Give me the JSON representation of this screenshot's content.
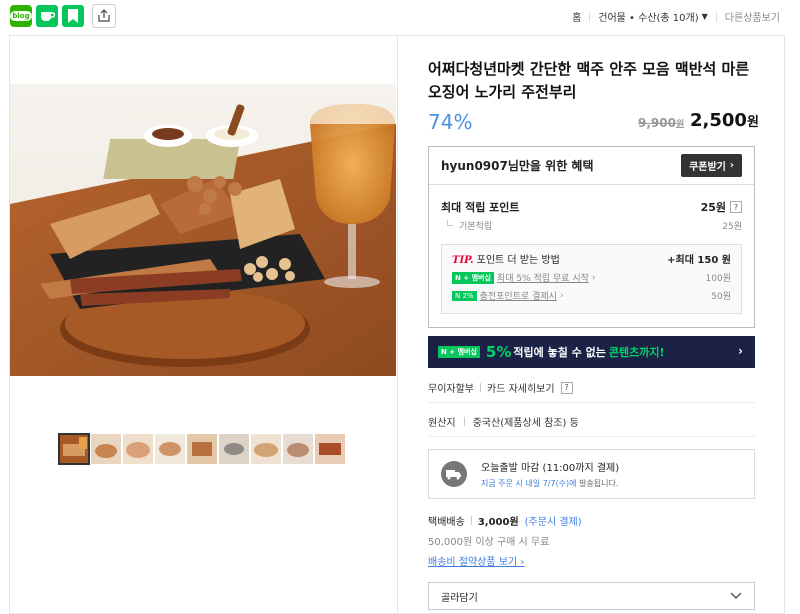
{
  "share_bar": {
    "blog_text": "blog",
    "icons": [
      "blog-icon",
      "cafe-icon",
      "bookmark-icon",
      "share-icon"
    ]
  },
  "breadcrumb": {
    "home": "홈",
    "category": "건어물 • 수산(총 10개)",
    "other": "다른상품보기"
  },
  "product": {
    "title": "어쩌다청년마켓 간단한 맥주 안주 모음 맥반석 마른 오징어 노가리 주전부리",
    "discount": "74%",
    "original_price": "9,900",
    "original_unit": "원",
    "price": "2,500",
    "price_unit": "원"
  },
  "benefit": {
    "title": "hyun0907님만을 위한 혜택",
    "coupon_button": "쿠폰받기",
    "max_points_label": "최대 적립 포인트",
    "max_points_value": "25원",
    "basic_label": "기본적립",
    "basic_value": "25원",
    "tip_label": "TIP.",
    "tip_text": "포인트 더 받는 방법",
    "tip_max": "+최대 150 원",
    "tip_items": [
      {
        "badge": "N + 멤버십",
        "text": "최대 5% 적립 무료 시작",
        "value": "100원"
      },
      {
        "badge": "N 2%",
        "text": "충전포인트로 결제시",
        "value": "50원"
      }
    ]
  },
  "banner": {
    "badge": "N + 멤버십",
    "pct": "5%",
    "text": "적립에 놓칠 수 없는",
    "highlight": "콘텐츠까지!"
  },
  "info": {
    "interest_free": "무이자할부",
    "card_detail": "카드 자세히보기",
    "origin_label": "원산지",
    "origin_value": "중국산(제품상세 참조) 등"
  },
  "delivery": {
    "title": "오늘출발 마감 (11:00까지 결제)",
    "sub_blue": "지금 주문 시 내일 7/7(수)에",
    "sub_rest": " 발송됩니다."
  },
  "shipping": {
    "label": "택배배송",
    "fee": "3,000원",
    "fee_note": "(주문시 결제)",
    "free_note": "50,000원 이상 구매 시 무료",
    "link": "배송비 절약상품 보기"
  },
  "option_select": {
    "placeholder": "골라담기"
  },
  "colors": {
    "naver_green": "#03c75a",
    "discount_blue": "#4a90e2",
    "banner_navy": "#1b2246"
  }
}
